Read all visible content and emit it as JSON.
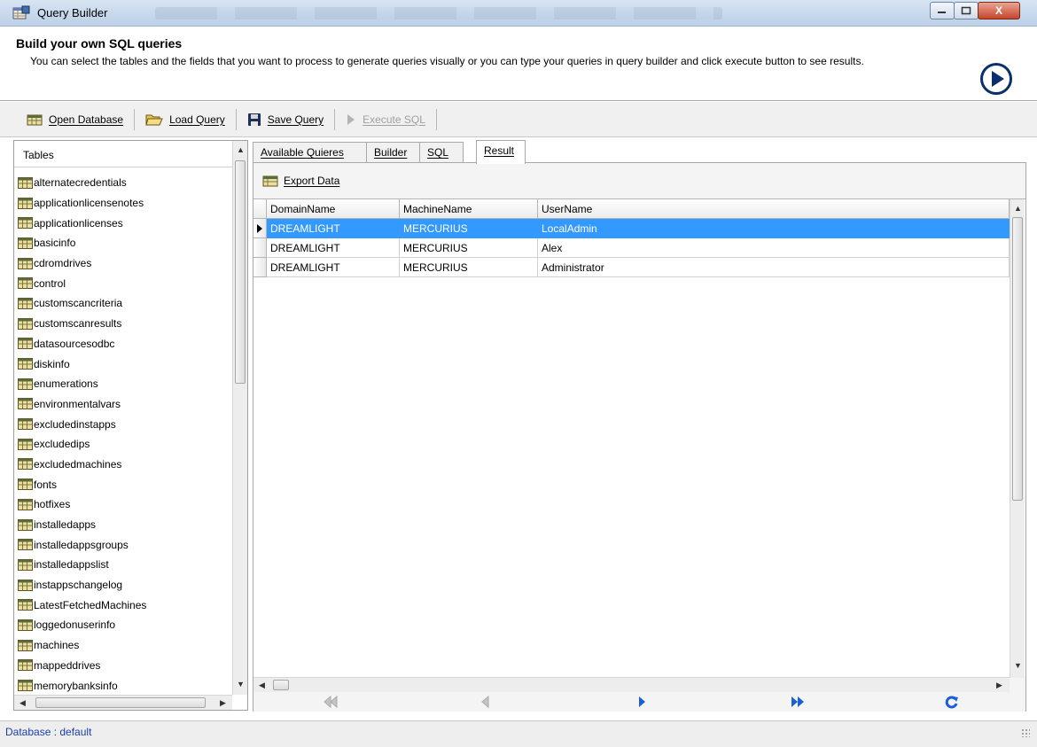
{
  "window": {
    "title": "Query Builder",
    "controls": {
      "minimize": "–",
      "maximize": "□",
      "close": "X"
    }
  },
  "header": {
    "title": "Build your own SQL queries",
    "description": "You can select the tables and the fields that you want to process to generate queries visually or you can type your queries in query builder and click execute button to see results."
  },
  "toolbar": {
    "open_database": "Open Database",
    "load_query": "Load Query",
    "save_query": "Save Query",
    "execute_sql": "Execute SQL"
  },
  "tables_panel": {
    "header": "Tables",
    "items": [
      "alternatecredentials",
      "applicationlicensenotes",
      "applicationlicenses",
      "basicinfo",
      "cdromdrives",
      "control",
      "customscancriteria",
      "customscanresults",
      "datasourcesodbc",
      "diskinfo",
      "enumerations",
      "environmentalvars",
      "excludedinstapps",
      "excludedips",
      "excludedmachines",
      "fonts",
      "hotfixes",
      "installedapps",
      "installedappsgroups",
      "installedappslist",
      "instappschangelog",
      "LatestFetchedMachines",
      "loggedonuserinfo",
      "machines",
      "mappeddrives",
      "memorybanksinfo"
    ]
  },
  "tabs": [
    {
      "label": "Available Quieres",
      "active": false
    },
    {
      "label": "Builder",
      "active": false
    },
    {
      "label": "SQL",
      "active": false
    },
    {
      "label": "Result",
      "active": true
    }
  ],
  "result": {
    "export_label": "Export Data",
    "columns": [
      "DomainName",
      "MachineName",
      "UserName"
    ],
    "rows": [
      [
        "DREAMLIGHT",
        "MERCURIUS",
        "LocalAdmin"
      ],
      [
        "DREAMLIGHT",
        "MERCURIUS",
        "Alex"
      ],
      [
        "DREAMLIGHT",
        "MERCURIUS",
        "Administrator"
      ]
    ],
    "selected_row": 0
  },
  "status": {
    "text": "Database : default"
  },
  "colors": {
    "selection": "#3399ff",
    "nav_active": "#1a5fd6",
    "nav_disabled": "#c4c4c4",
    "status_text": "#1a3ea8"
  }
}
